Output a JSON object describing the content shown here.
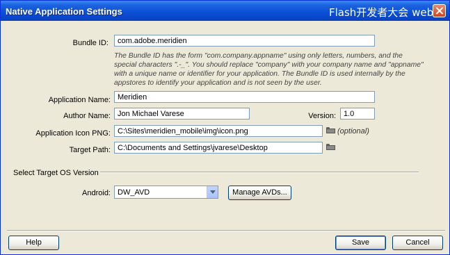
{
  "window": {
    "title": "Native Application Settings",
    "watermark": "Flash开发者大会 web"
  },
  "form": {
    "bundle_id_label": "Bundle ID:",
    "bundle_id_value": "com.adobe.meridien",
    "bundle_id_help": "The Bundle ID has the form \"com.company.appname\" using only letters, numbers, and the special characters \".-_\". You should replace \"company\" with your company name and \"appname\" with a unique name or identifier for your application. The Bundle ID is used internally by the appstores to identify your application and is not seen by the user.",
    "app_name_label": "Application Name:",
    "app_name_value": "Meridien",
    "author_label": "Author Name:",
    "author_value": "Jon Michael Varese",
    "version_label": "Version:",
    "version_value": "1.0",
    "icon_label": "Application Icon PNG:",
    "icon_value": "C:\\Sites\\meridien_mobile\\img\\icon.png",
    "icon_optional": "(optional)",
    "target_label": "Target Path:",
    "target_value": "C:\\Documents and Settings\\jvarese\\Desktop"
  },
  "os": {
    "section_label": "Select Target OS Version",
    "android_label": "Android:",
    "android_selected": "DW_AVD",
    "manage_label": "Manage AVDs..."
  },
  "buttons": {
    "help": "Help",
    "save": "Save",
    "cancel": "Cancel"
  }
}
